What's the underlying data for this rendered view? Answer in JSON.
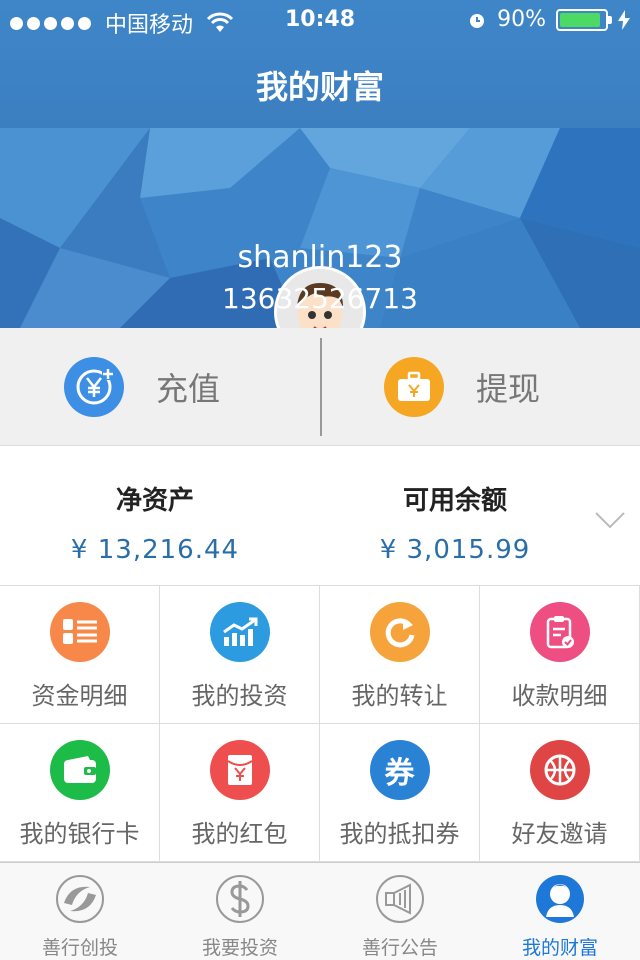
{
  "status_bar": {
    "carrier": "中国移动",
    "time": "10:48",
    "battery": "90%",
    "battery_level": 0.9
  },
  "nav": {
    "title": "我的财富"
  },
  "profile": {
    "username": "shanlin123",
    "phone": "13632526713"
  },
  "actions": {
    "recharge_label": "充值",
    "withdraw_label": "提现"
  },
  "assets": {
    "net_title": "净资产",
    "net_value": "¥ 13,216.44",
    "available_title": "可用余额",
    "available_value": "¥ 3,015.99"
  },
  "grid": [
    {
      "label": "资金明细",
      "icon": "list-icon",
      "color": "#f7884a"
    },
    {
      "label": "我的投资",
      "icon": "trend-chart-icon",
      "color": "#2d9be0"
    },
    {
      "label": "我的转让",
      "icon": "refresh-icon",
      "color": "#f7a33c"
    },
    {
      "label": "收款明细",
      "icon": "clipboard-check-icon",
      "color": "#ef4e83"
    },
    {
      "label": "我的银行卡",
      "icon": "wallet-icon",
      "color": "#1dbb47"
    },
    {
      "label": "我的红包",
      "icon": "red-envelope-icon",
      "color": "#ee4e4e"
    },
    {
      "label": "我的抵扣券",
      "icon": "coupon-icon",
      "color": "#2a82d4"
    },
    {
      "label": "好友邀请",
      "icon": "basketball-icon",
      "color": "#e04545"
    }
  ],
  "grid_voucher_glyph": "券",
  "tabs": [
    {
      "label": "善行创投",
      "icon": "orbit-logo-icon",
      "active": false
    },
    {
      "label": "我要投资",
      "icon": "dollar-icon",
      "active": false
    },
    {
      "label": "善行公告",
      "icon": "megaphone-icon",
      "active": false
    },
    {
      "label": "我的财富",
      "icon": "user-icon",
      "active": true
    }
  ],
  "colors": {
    "header_blue": "#3f86c9",
    "accent_blue": "#1e78d8",
    "recharge_blue": "#3d8fe6",
    "withdraw_orange": "#f5a623"
  }
}
